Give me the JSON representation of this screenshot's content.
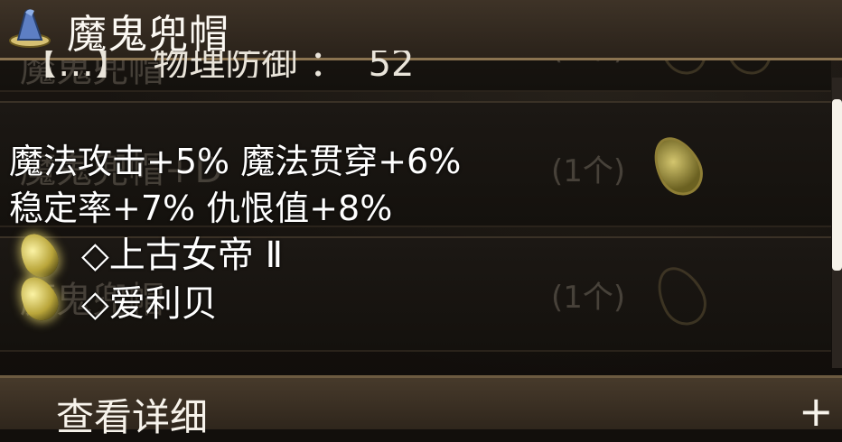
{
  "header": {
    "title": "魔鬼兜帽",
    "icon": "wizard-hat-icon"
  },
  "partial_line": "【…】  物理防御 ：  52",
  "background_list": [
    {
      "name": "魔鬼兜帽",
      "count": "(1个)"
    },
    {
      "name": "魔鬼兜帽+D",
      "count": "(1个)"
    },
    {
      "name": "魔鬼兜帽",
      "count": "(1个)"
    }
  ],
  "stats": {
    "line1": "魔法攻击+5% 魔法贯穿+6%",
    "line2": "稳定率+7% 仇恨值+8%"
  },
  "gems": [
    {
      "label": "◇上古女帝 Ⅱ",
      "icon": "yellow-gem-icon"
    },
    {
      "label": "◇爱利贝",
      "icon": "yellow-gem-icon"
    }
  ],
  "footer": {
    "label": "查看详细",
    "action": "+"
  }
}
